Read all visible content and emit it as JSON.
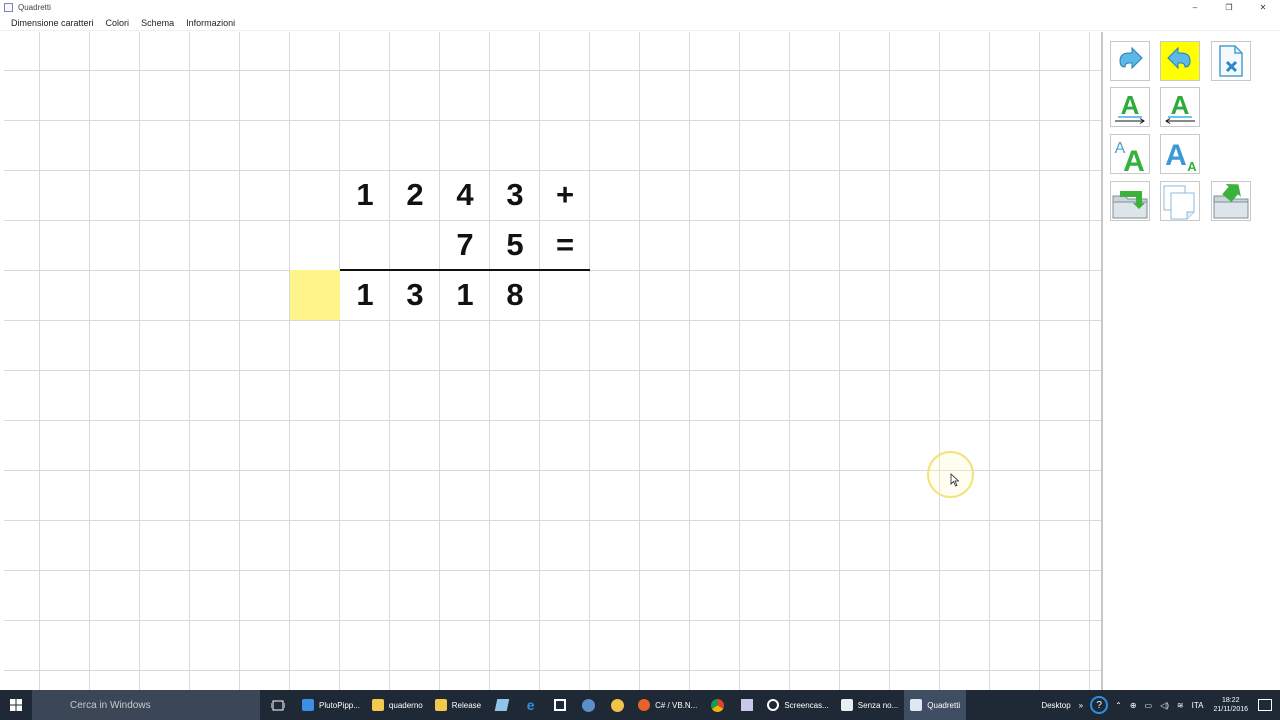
{
  "window": {
    "title": "Quadretti",
    "minimize": "–",
    "restore": "❐",
    "close": "✕"
  },
  "menu": [
    "Dimensione caratteri",
    "Colori",
    "Schema",
    "Informazioni"
  ],
  "worksheet": {
    "row1": [
      "1",
      "2",
      "4",
      "3",
      "+"
    ],
    "row2": [
      "7",
      "5",
      "="
    ],
    "result": [
      "1",
      "3",
      "1",
      "8"
    ],
    "highlight_color": "#fff48a"
  },
  "toolbar": {
    "buttons": [
      {
        "name": "arrow-right-icon",
        "active": false
      },
      {
        "name": "arrow-left-icon",
        "active": true
      },
      {
        "name": "close-document-icon",
        "active": false
      },
      {
        "name": "text-direction-right-icon",
        "active": false
      },
      {
        "name": "text-direction-left-icon",
        "active": false
      },
      {
        "name": "font-size-increase-icon",
        "active": false
      },
      {
        "name": "font-size-decrease-icon",
        "active": false
      },
      {
        "name": "open-folder-icon",
        "active": false
      },
      {
        "name": "new-page-icon",
        "active": false
      },
      {
        "name": "save-folder-icon",
        "active": false
      }
    ],
    "letter": "A",
    "active_color": "#ffff00"
  },
  "taskbar": {
    "search_placeholder": "Cerca in Windows",
    "tasks": [
      "PlutoPipp...",
      "quaderno",
      "Release",
      "C# / VB.N...",
      "Screencas...",
      "Senza no...",
      "Quadretti"
    ],
    "desktop_label": "Desktop",
    "language": "ITA",
    "time": "18:22",
    "date": "21/11/2016"
  }
}
